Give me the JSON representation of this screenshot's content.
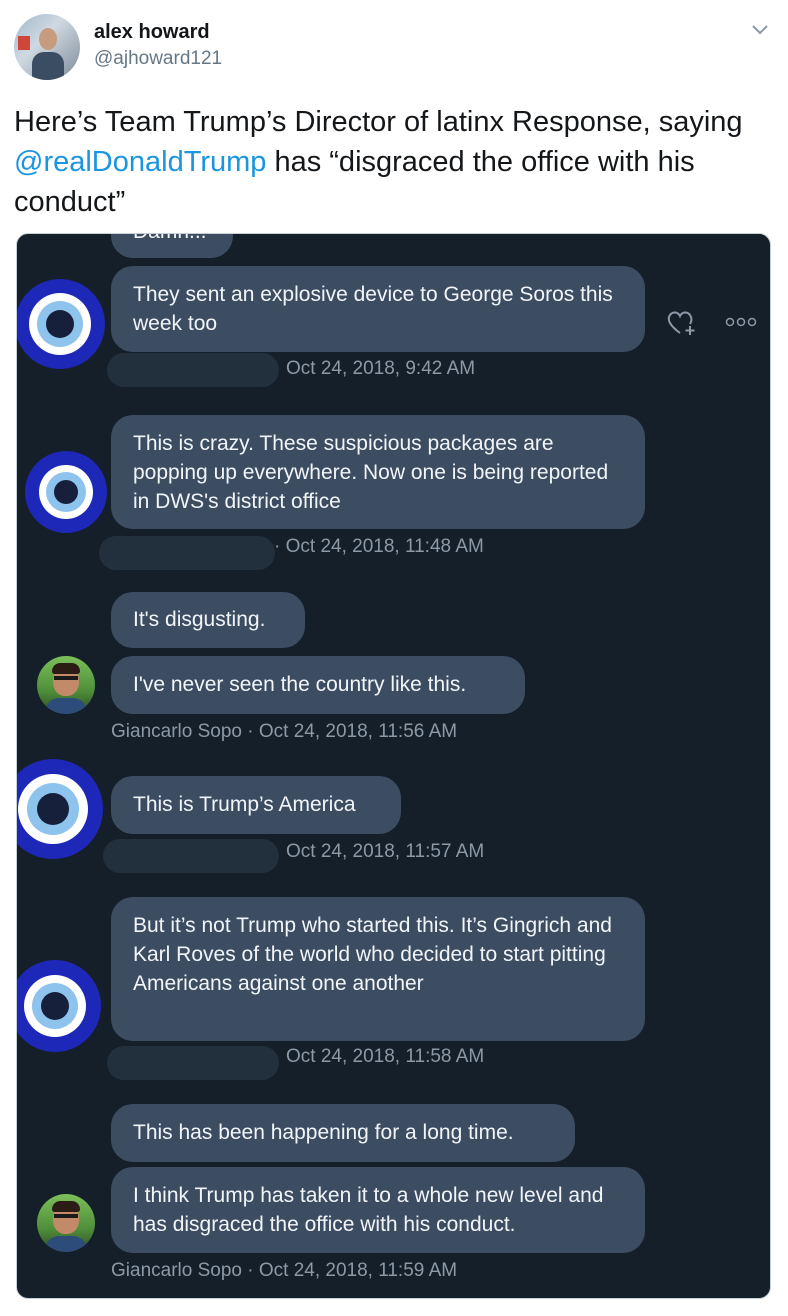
{
  "header": {
    "name": "alex howard",
    "handle": "@ajhoward121"
  },
  "tweet": {
    "text_before": "Here’s Team Trump’s Director of latinx Response, saying ",
    "mention": "@realDonaldTrump",
    "text_after": " has “disgraced the office with his conduct”"
  },
  "icons": {
    "caret": "chevron-down-icon",
    "react": "heart-add-icon",
    "more": "more-icon",
    "avatar_eye": "evil-eye-icon"
  },
  "colors": {
    "screenshot_background": "#151f2a",
    "bubble": "#3c4d62",
    "mention": "#1b95e0",
    "eye_blue": "#1e28b8"
  },
  "messages": [
    {
      "text": "Damn..."
    },
    {
      "text": "They sent an explosive device to George Soros this week too"
    },
    {
      "text": "This is crazy. These suspicious packages are popping up everywhere. Now one is being reported in DWS's district office"
    },
    {
      "text": "It's disgusting."
    },
    {
      "text": "I've never seen the country like this."
    },
    {
      "text": "This is Trump’s America"
    },
    {
      "text": "But it’s not Trump who started this. It’s Gingrich and Karl Roves of the world who decided to start pitting Americans against one another"
    },
    {
      "text": "This has been happening for a long time."
    },
    {
      "text": "I think Trump has taken it to a whole new level and has disgraced the office with his conduct."
    }
  ],
  "meta": [
    {
      "text": "Oct 24, 2018, 9:42 AM"
    },
    {
      "text": "· Oct 24, 2018, 11:48 AM"
    },
    {
      "text": "Giancarlo Sopo · Oct 24, 2018, 11:56 AM"
    },
    {
      "text": "Oct 24, 2018, 11:57 AM"
    },
    {
      "text": "Oct 24, 2018, 11:58 AM"
    },
    {
      "text": "Giancarlo Sopo · Oct 24, 2018, 11:59 AM"
    }
  ]
}
